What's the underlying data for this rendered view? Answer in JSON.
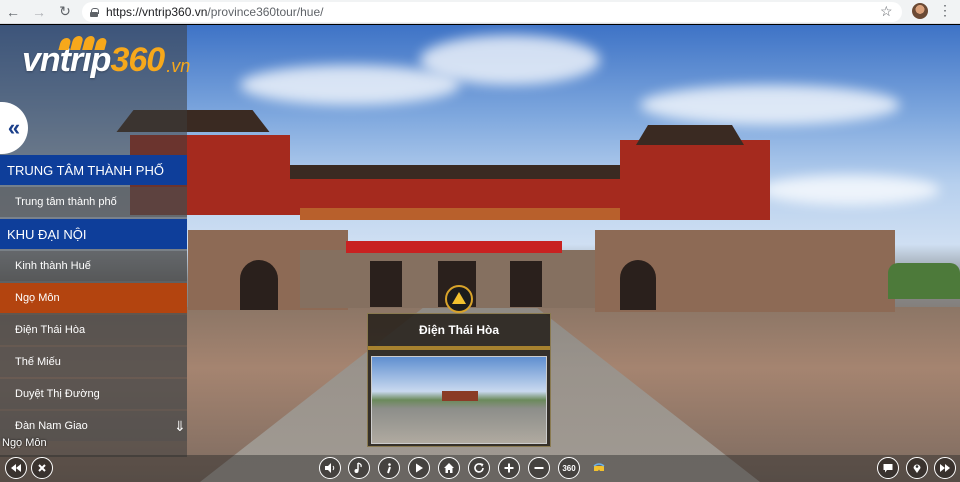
{
  "browser": {
    "url_host": "https://vntrip360.vn",
    "url_path": "/province360tour/hue/"
  },
  "logo": {
    "text_main": "vntrip",
    "text_num": "360",
    "text_sub": ".vn"
  },
  "sidebar": {
    "sections": [
      {
        "header": "TRUNG TÂM THÀNH PHỐ",
        "items": [
          {
            "label": "Trung tâm thành phố",
            "active": false
          }
        ]
      },
      {
        "header": "KHU ĐẠI NỘI",
        "items": [
          {
            "label": "Kinh thành Huế",
            "active": false
          },
          {
            "label": "Ngọ Môn",
            "active": true
          },
          {
            "label": "Điện Thái Hòa",
            "active": false
          },
          {
            "label": "Thế Miếu",
            "active": false
          },
          {
            "label": "Duyệt Thị Đường",
            "active": false
          },
          {
            "label": "Đàn Nam Giao",
            "active": false
          }
        ]
      }
    ]
  },
  "current_scene": "Ngọ Môn",
  "hotspot_preview": {
    "title": "Điện Thái Hòa"
  },
  "toolbar": {
    "btn_360_label": "360"
  },
  "colors": {
    "header_blue": "#0e3e9a",
    "active_orange": "#b3440f",
    "logo_orange": "#f7a81b"
  }
}
